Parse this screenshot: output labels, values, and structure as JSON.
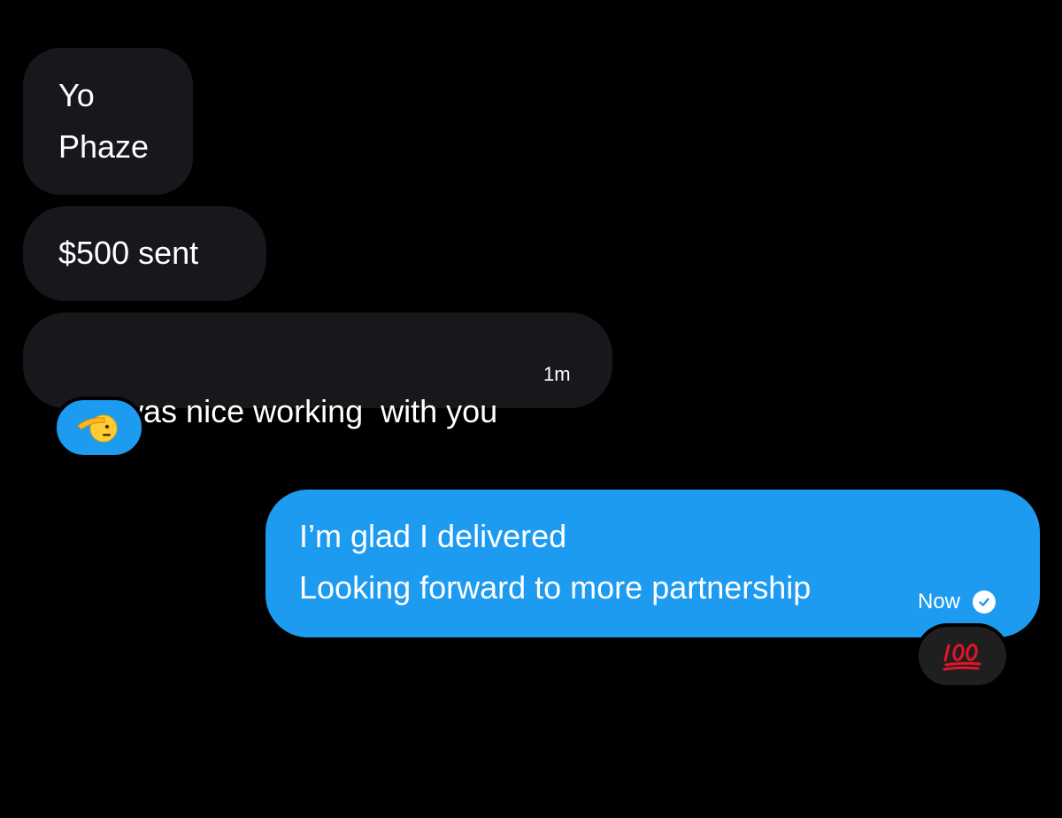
{
  "messages": [
    {
      "direction": "received",
      "lines": [
        "Yo",
        "Phaze"
      ]
    },
    {
      "direction": "received",
      "lines": [
        "$500 sent"
      ]
    },
    {
      "direction": "received",
      "lines": [
        "It was nice working  with you"
      ],
      "timestamp": "1m",
      "reaction": "saluting-face-emoji"
    },
    {
      "direction": "sent",
      "lines": [
        "I’m glad I delivered",
        "Looking forward to more partnership"
      ],
      "timestamp": "Now",
      "status": "read",
      "reaction": "hundred-points-emoji"
    }
  ],
  "colors": {
    "background": "#000000",
    "received_bubble": "#17181c",
    "sent_bubble": "#1d9bf0",
    "text": "#ffffff"
  }
}
